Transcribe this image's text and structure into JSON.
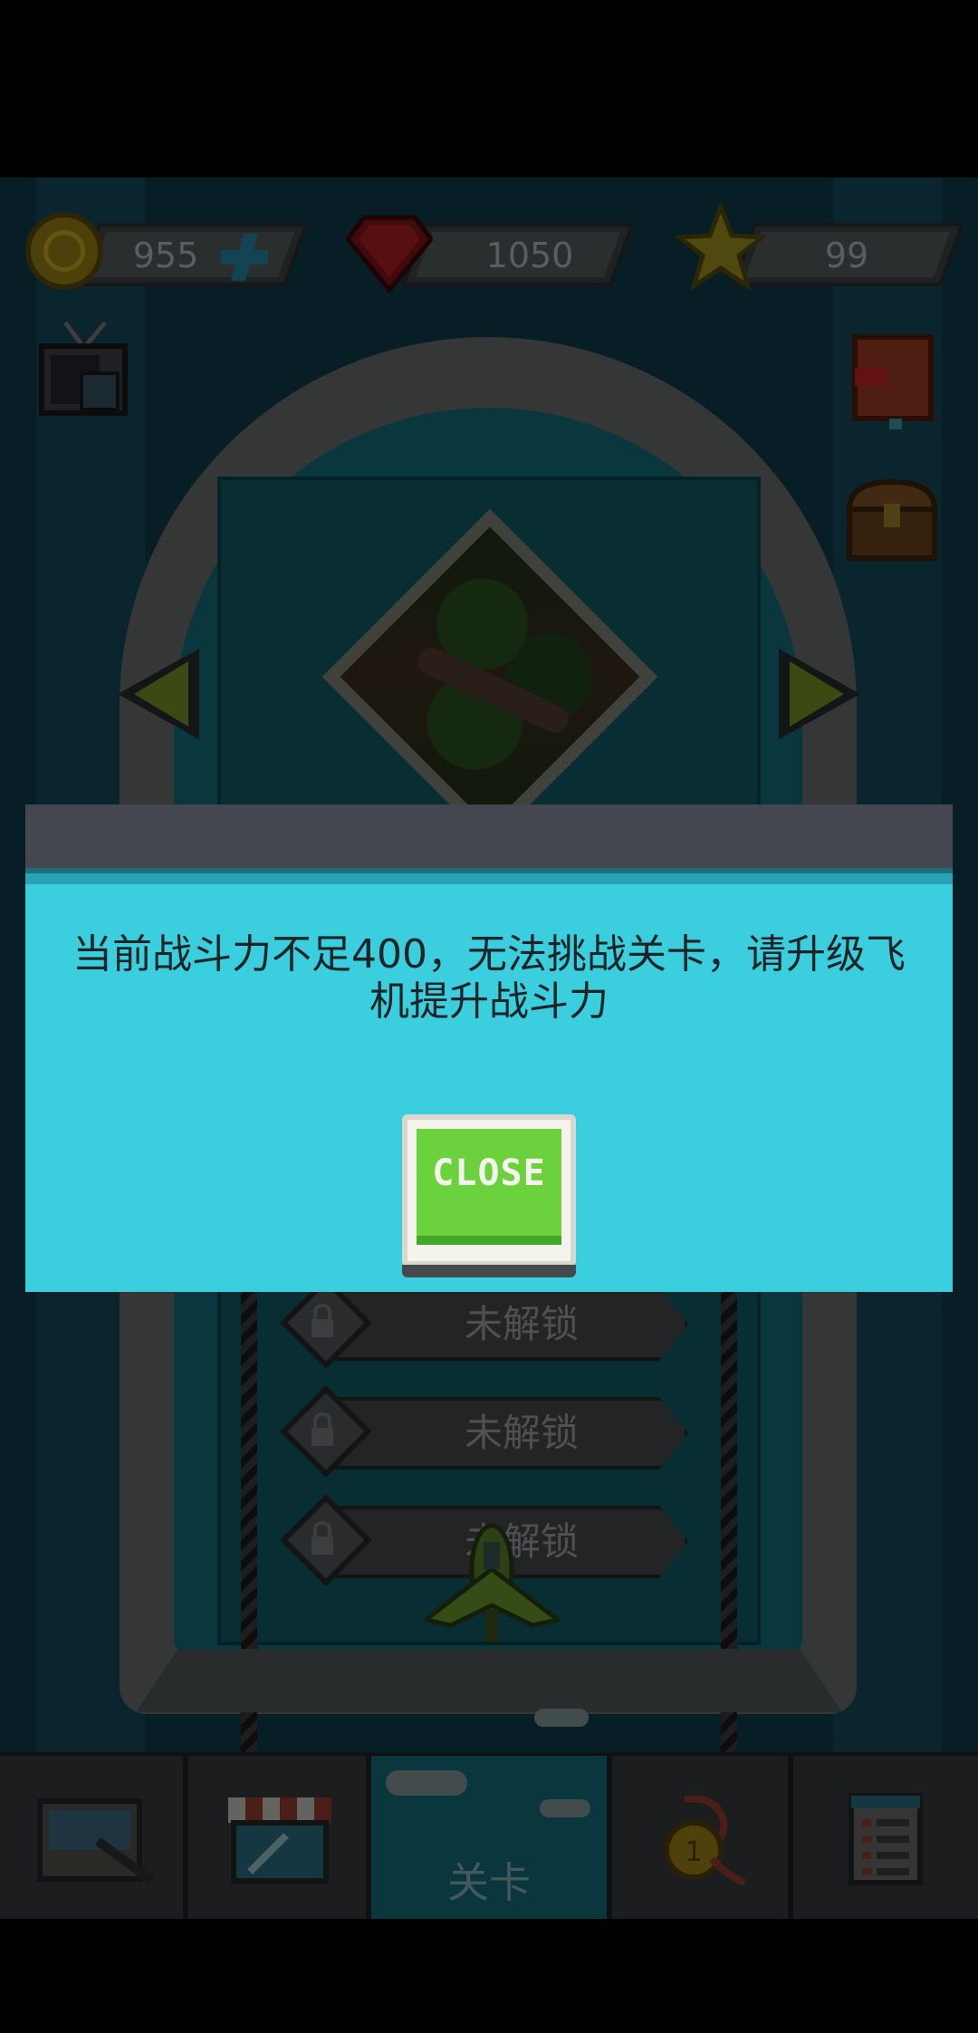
{
  "resources": {
    "coins": "955",
    "gems": "1050",
    "stars": "99"
  },
  "levels": [
    {
      "label": "未解锁"
    },
    {
      "label": "未解锁"
    },
    {
      "label": "未解锁"
    }
  ],
  "nav": {
    "items": [
      {
        "id": "hangar",
        "label": ""
      },
      {
        "id": "shop",
        "label": ""
      },
      {
        "id": "levels",
        "label": "关卡"
      },
      {
        "id": "rewards",
        "label": ""
      },
      {
        "id": "tasks",
        "label": ""
      }
    ],
    "active": "levels"
  },
  "modal": {
    "message": "当前战斗力不足400，无法挑战关卡，请升级飞机提升战斗力",
    "close_label": "CLOSE"
  },
  "colors": {
    "modal_body": "#3bcede",
    "modal_header": "#444750",
    "close_button": "#6bd13d",
    "game_background": "#0b2a36"
  }
}
